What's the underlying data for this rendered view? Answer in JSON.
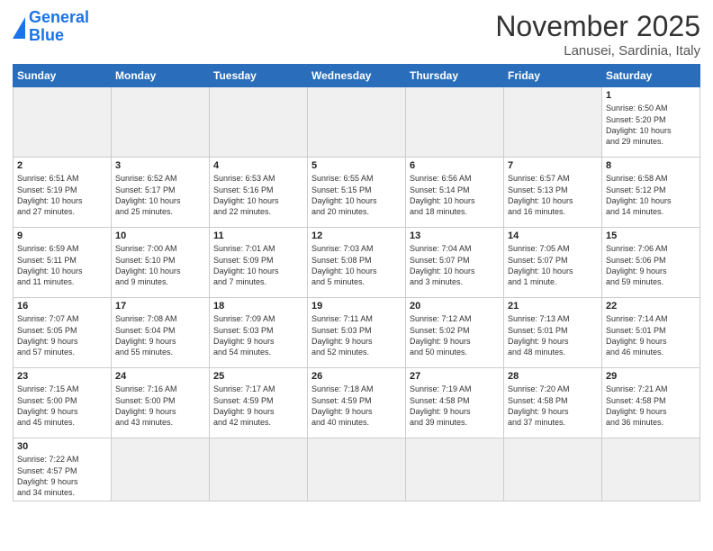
{
  "logo": {
    "line1": "General",
    "line2": "Blue"
  },
  "title": "November 2025",
  "subtitle": "Lanusei, Sardinia, Italy",
  "days_header": [
    "Sunday",
    "Monday",
    "Tuesday",
    "Wednesday",
    "Thursday",
    "Friday",
    "Saturday"
  ],
  "weeks": [
    [
      {
        "num": "",
        "info": "",
        "empty": true
      },
      {
        "num": "",
        "info": "",
        "empty": true
      },
      {
        "num": "",
        "info": "",
        "empty": true
      },
      {
        "num": "",
        "info": "",
        "empty": true
      },
      {
        "num": "",
        "info": "",
        "empty": true
      },
      {
        "num": "",
        "info": "",
        "empty": true
      },
      {
        "num": "1",
        "info": "Sunrise: 6:50 AM\nSunset: 5:20 PM\nDaylight: 10 hours\nand 29 minutes.",
        "empty": false
      }
    ],
    [
      {
        "num": "2",
        "info": "Sunrise: 6:51 AM\nSunset: 5:19 PM\nDaylight: 10 hours\nand 27 minutes.",
        "empty": false
      },
      {
        "num": "3",
        "info": "Sunrise: 6:52 AM\nSunset: 5:17 PM\nDaylight: 10 hours\nand 25 minutes.",
        "empty": false
      },
      {
        "num": "4",
        "info": "Sunrise: 6:53 AM\nSunset: 5:16 PM\nDaylight: 10 hours\nand 22 minutes.",
        "empty": false
      },
      {
        "num": "5",
        "info": "Sunrise: 6:55 AM\nSunset: 5:15 PM\nDaylight: 10 hours\nand 20 minutes.",
        "empty": false
      },
      {
        "num": "6",
        "info": "Sunrise: 6:56 AM\nSunset: 5:14 PM\nDaylight: 10 hours\nand 18 minutes.",
        "empty": false
      },
      {
        "num": "7",
        "info": "Sunrise: 6:57 AM\nSunset: 5:13 PM\nDaylight: 10 hours\nand 16 minutes.",
        "empty": false
      },
      {
        "num": "8",
        "info": "Sunrise: 6:58 AM\nSunset: 5:12 PM\nDaylight: 10 hours\nand 14 minutes.",
        "empty": false
      }
    ],
    [
      {
        "num": "9",
        "info": "Sunrise: 6:59 AM\nSunset: 5:11 PM\nDaylight: 10 hours\nand 11 minutes.",
        "empty": false
      },
      {
        "num": "10",
        "info": "Sunrise: 7:00 AM\nSunset: 5:10 PM\nDaylight: 10 hours\nand 9 minutes.",
        "empty": false
      },
      {
        "num": "11",
        "info": "Sunrise: 7:01 AM\nSunset: 5:09 PM\nDaylight: 10 hours\nand 7 minutes.",
        "empty": false
      },
      {
        "num": "12",
        "info": "Sunrise: 7:03 AM\nSunset: 5:08 PM\nDaylight: 10 hours\nand 5 minutes.",
        "empty": false
      },
      {
        "num": "13",
        "info": "Sunrise: 7:04 AM\nSunset: 5:07 PM\nDaylight: 10 hours\nand 3 minutes.",
        "empty": false
      },
      {
        "num": "14",
        "info": "Sunrise: 7:05 AM\nSunset: 5:07 PM\nDaylight: 10 hours\nand 1 minute.",
        "empty": false
      },
      {
        "num": "15",
        "info": "Sunrise: 7:06 AM\nSunset: 5:06 PM\nDaylight: 9 hours\nand 59 minutes.",
        "empty": false
      }
    ],
    [
      {
        "num": "16",
        "info": "Sunrise: 7:07 AM\nSunset: 5:05 PM\nDaylight: 9 hours\nand 57 minutes.",
        "empty": false
      },
      {
        "num": "17",
        "info": "Sunrise: 7:08 AM\nSunset: 5:04 PM\nDaylight: 9 hours\nand 55 minutes.",
        "empty": false
      },
      {
        "num": "18",
        "info": "Sunrise: 7:09 AM\nSunset: 5:03 PM\nDaylight: 9 hours\nand 54 minutes.",
        "empty": false
      },
      {
        "num": "19",
        "info": "Sunrise: 7:11 AM\nSunset: 5:03 PM\nDaylight: 9 hours\nand 52 minutes.",
        "empty": false
      },
      {
        "num": "20",
        "info": "Sunrise: 7:12 AM\nSunset: 5:02 PM\nDaylight: 9 hours\nand 50 minutes.",
        "empty": false
      },
      {
        "num": "21",
        "info": "Sunrise: 7:13 AM\nSunset: 5:01 PM\nDaylight: 9 hours\nand 48 minutes.",
        "empty": false
      },
      {
        "num": "22",
        "info": "Sunrise: 7:14 AM\nSunset: 5:01 PM\nDaylight: 9 hours\nand 46 minutes.",
        "empty": false
      }
    ],
    [
      {
        "num": "23",
        "info": "Sunrise: 7:15 AM\nSunset: 5:00 PM\nDaylight: 9 hours\nand 45 minutes.",
        "empty": false
      },
      {
        "num": "24",
        "info": "Sunrise: 7:16 AM\nSunset: 5:00 PM\nDaylight: 9 hours\nand 43 minutes.",
        "empty": false
      },
      {
        "num": "25",
        "info": "Sunrise: 7:17 AM\nSunset: 4:59 PM\nDaylight: 9 hours\nand 42 minutes.",
        "empty": false
      },
      {
        "num": "26",
        "info": "Sunrise: 7:18 AM\nSunset: 4:59 PM\nDaylight: 9 hours\nand 40 minutes.",
        "empty": false
      },
      {
        "num": "27",
        "info": "Sunrise: 7:19 AM\nSunset: 4:58 PM\nDaylight: 9 hours\nand 39 minutes.",
        "empty": false
      },
      {
        "num": "28",
        "info": "Sunrise: 7:20 AM\nSunset: 4:58 PM\nDaylight: 9 hours\nand 37 minutes.",
        "empty": false
      },
      {
        "num": "29",
        "info": "Sunrise: 7:21 AM\nSunset: 4:58 PM\nDaylight: 9 hours\nand 36 minutes.",
        "empty": false
      }
    ],
    [
      {
        "num": "30",
        "info": "Sunrise: 7:22 AM\nSunset: 4:57 PM\nDaylight: 9 hours\nand 34 minutes.",
        "empty": false
      },
      {
        "num": "",
        "info": "",
        "empty": true
      },
      {
        "num": "",
        "info": "",
        "empty": true
      },
      {
        "num": "",
        "info": "",
        "empty": true
      },
      {
        "num": "",
        "info": "",
        "empty": true
      },
      {
        "num": "",
        "info": "",
        "empty": true
      },
      {
        "num": "",
        "info": "",
        "empty": true
      }
    ]
  ]
}
